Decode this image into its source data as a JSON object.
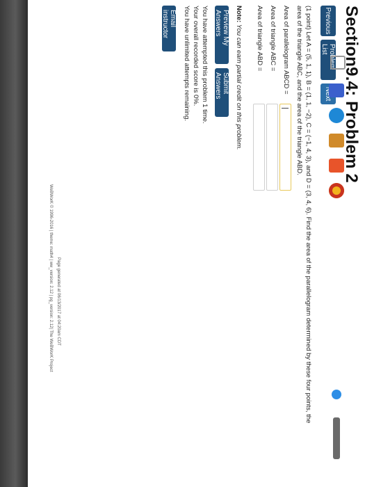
{
  "header": {
    "title": "Section9.4: Problem 2"
  },
  "nav": {
    "previous": "Previous",
    "problem_list": "Problem List",
    "next": "Next"
  },
  "problem": {
    "line1": "(1 point) Let A = (5, 1, 1), B = (1, 1, −2), C = (−1, 4, 3), and D = (3, 4, 6). Find the area of the parallelogram determined by these four points, the",
    "line2": "area of the triangle ABC, and the area of the triangle ABD."
  },
  "answers": [
    {
      "label": "Area of parallelogram ABCD =",
      "value": ""
    },
    {
      "label": "Area of triangle ABC =",
      "value": ""
    },
    {
      "label": "Area of triangle ABD =",
      "value": ""
    }
  ],
  "note": {
    "bold": "Note:",
    "text": "You can earn partial credit on this problem."
  },
  "buttons": {
    "preview": "Preview My Answers",
    "submit": "Submit Answers",
    "email": "Email instructor"
  },
  "status": {
    "line1": "You have attempted this problem 1 time.",
    "line2": "Your overall recorded score is 0%.",
    "line3": "You have unlimited attempts remaining."
  },
  "footer": {
    "generated": "Page generated at 06/13/2017 at 04:20am CDT",
    "copyright": "WeBWorK © 1996-2016 | theme: math4 | ww_version: 2.12 | pg_version: 2.12| The WeBWorK Project"
  },
  "colors": {
    "nav_dark": "#1f4f7a",
    "nav_blue": "#2b6fa8",
    "active_field": "#e8c95a"
  }
}
